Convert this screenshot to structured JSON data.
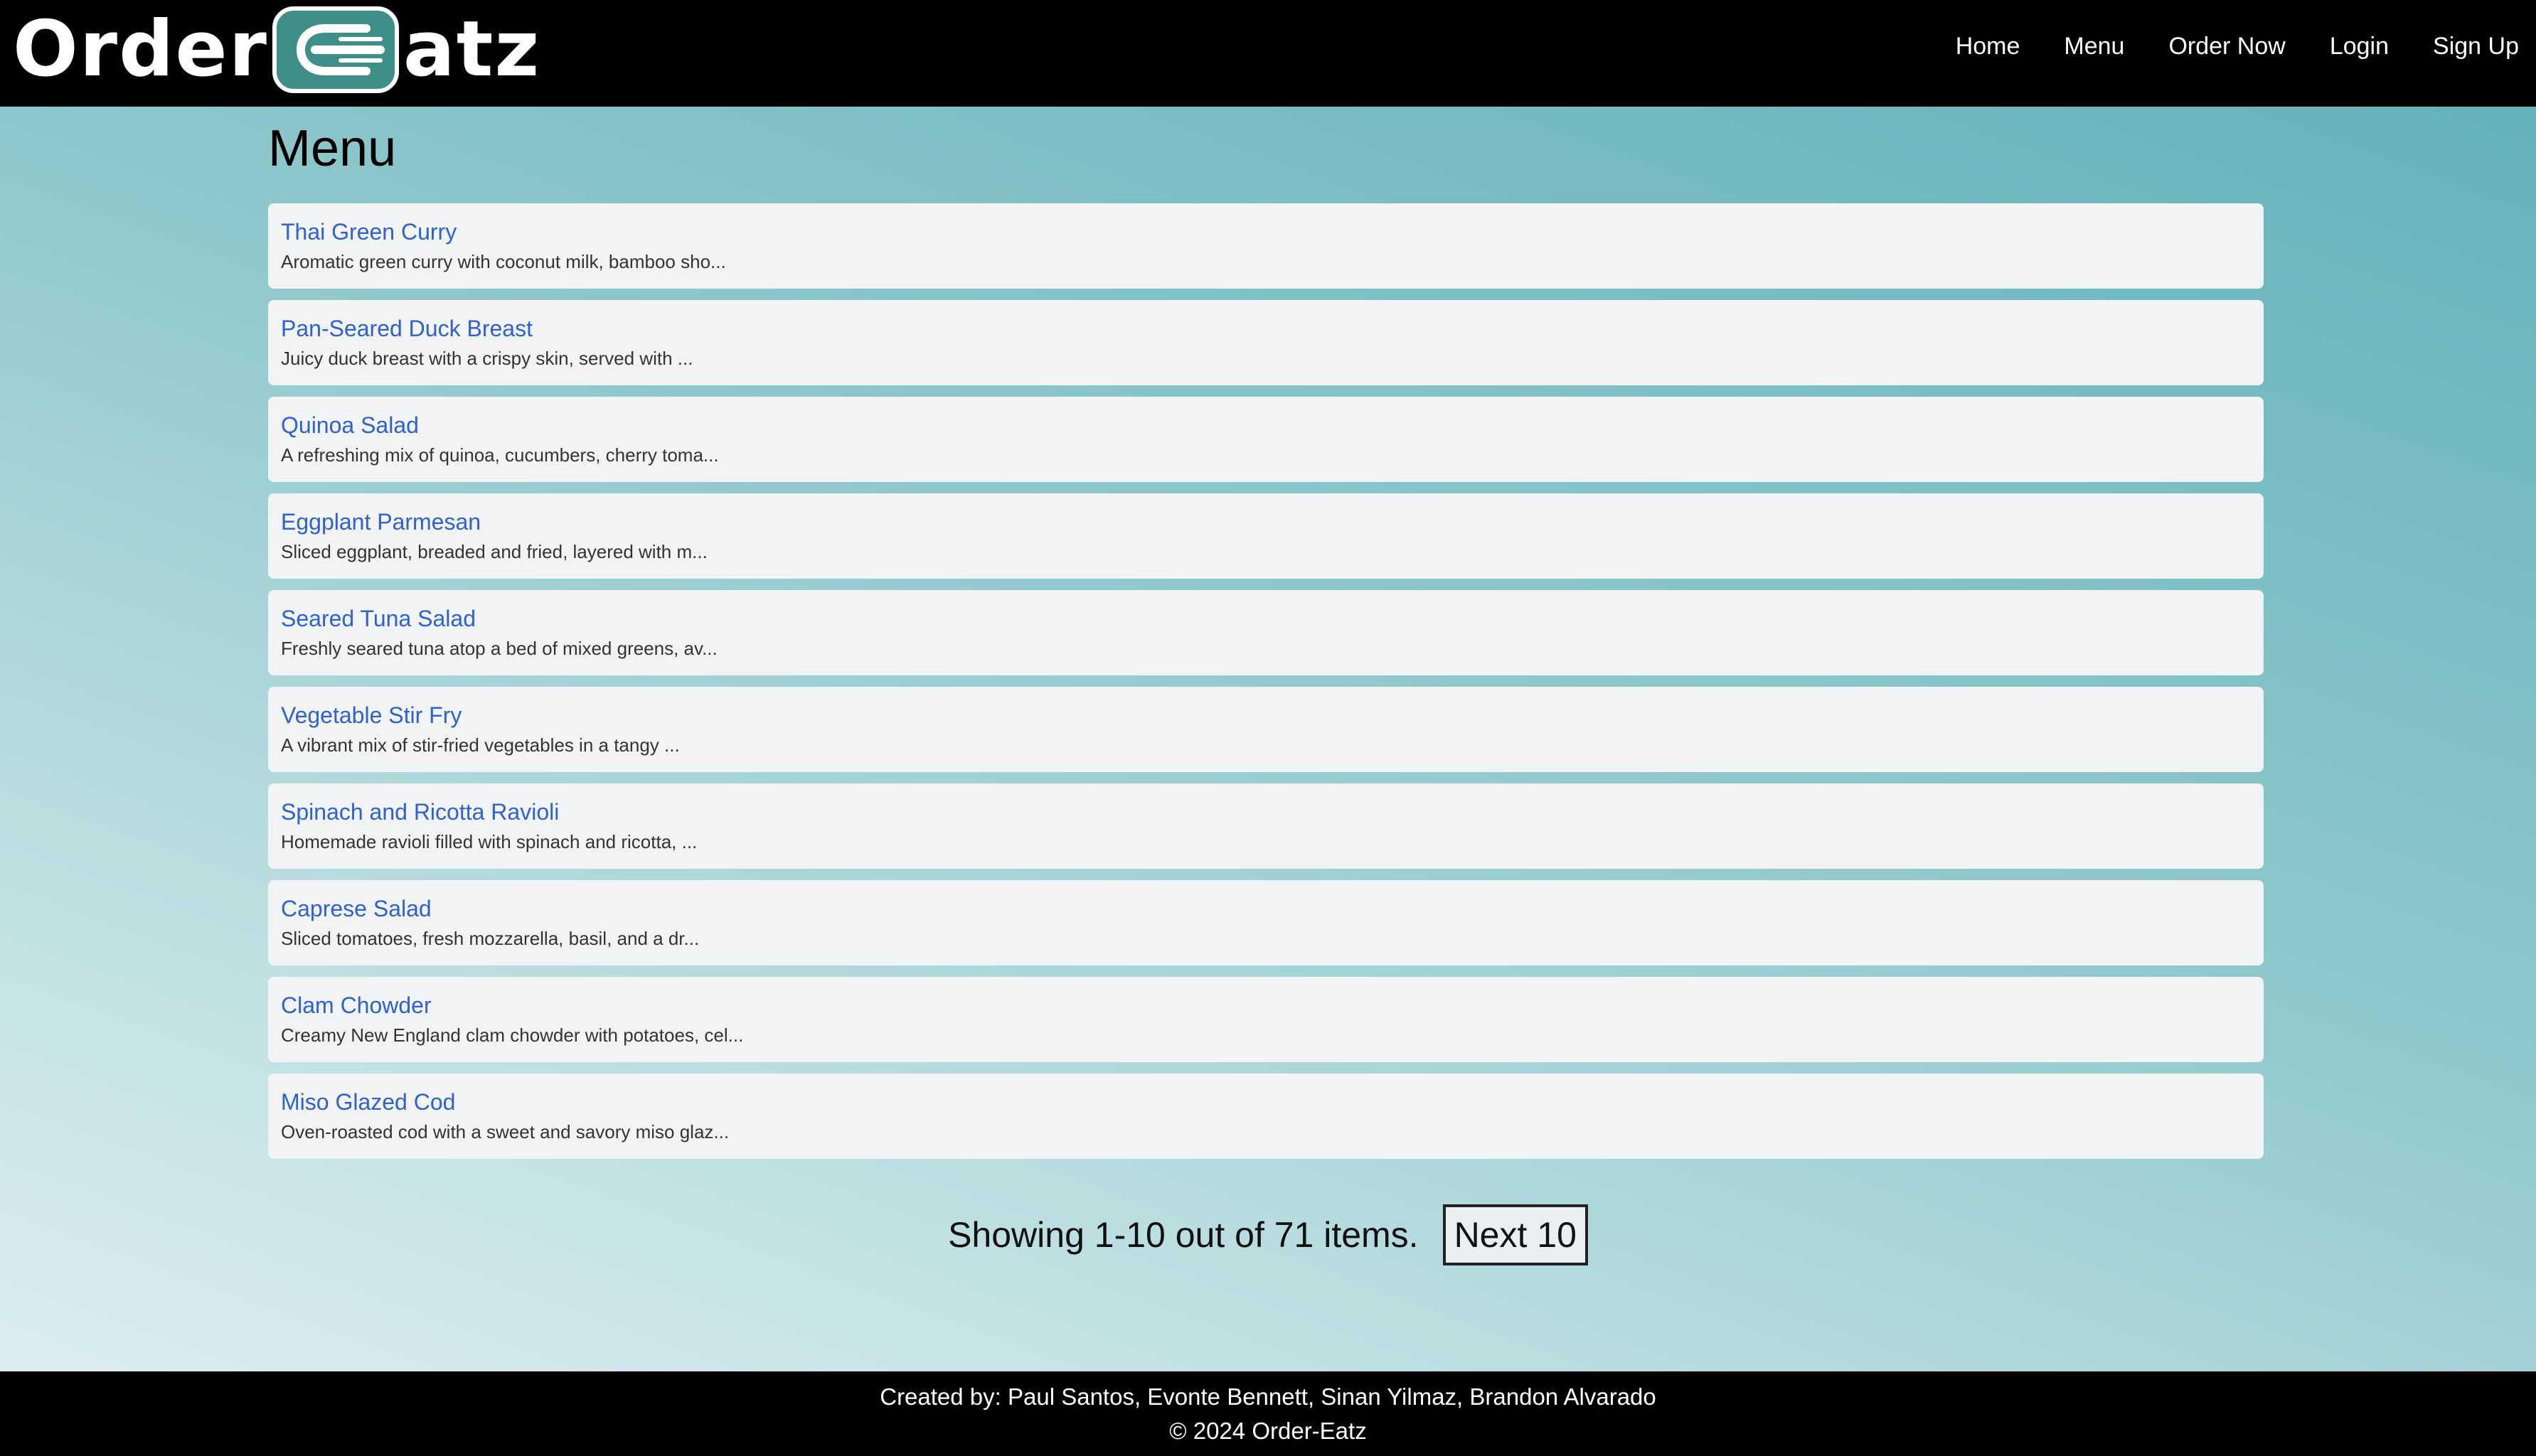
{
  "brand": {
    "name_left": "Order",
    "name_right": "atz",
    "badge_icon": "fork-icon",
    "badge_color": "#3f8f89"
  },
  "nav": {
    "items": [
      {
        "label": "Home"
      },
      {
        "label": "Menu"
      },
      {
        "label": "Order Now"
      },
      {
        "label": "Login"
      },
      {
        "label": "Sign Up"
      }
    ]
  },
  "page": {
    "title": "Menu"
  },
  "menu_items": [
    {
      "name": "Thai Green Curry",
      "description": "Aromatic green curry with coconut milk, bamboo sho..."
    },
    {
      "name": "Pan-Seared Duck Breast",
      "description": "Juicy duck breast with a crispy skin, served with ..."
    },
    {
      "name": "Quinoa Salad",
      "description": "A refreshing mix of quinoa, cucumbers, cherry toma..."
    },
    {
      "name": "Eggplant Parmesan",
      "description": "Sliced eggplant, breaded and fried, layered with m..."
    },
    {
      "name": "Seared Tuna Salad",
      "description": "Freshly seared tuna atop a bed of mixed greens, av..."
    },
    {
      "name": "Vegetable Stir Fry",
      "description": "A vibrant mix of stir-fried vegetables in a tangy ..."
    },
    {
      "name": "Spinach and Ricotta Ravioli",
      "description": "Homemade ravioli filled with spinach and ricotta, ..."
    },
    {
      "name": "Caprese Salad",
      "description": "Sliced tomatoes, fresh mozzarella, basil, and a dr..."
    },
    {
      "name": "Clam Chowder",
      "description": "Creamy New England clam chowder with potatoes, cel..."
    },
    {
      "name": "Miso Glazed Cod",
      "description": "Oven-roasted cod with a sweet and savory miso glaz..."
    }
  ],
  "pagination": {
    "summary": "Showing 1-10 out of 71 items.",
    "next_label": "Next 10"
  },
  "footer": {
    "credits": "Created by: Paul Santos, Evonte Bennett, Sinan Yilmaz, Brandon Alvarado",
    "copyright": "© 2024 Order-Eatz"
  },
  "colors": {
    "header_bg": "#000000",
    "link": "#2e61d1",
    "card_bg": "#f2f3f5"
  }
}
